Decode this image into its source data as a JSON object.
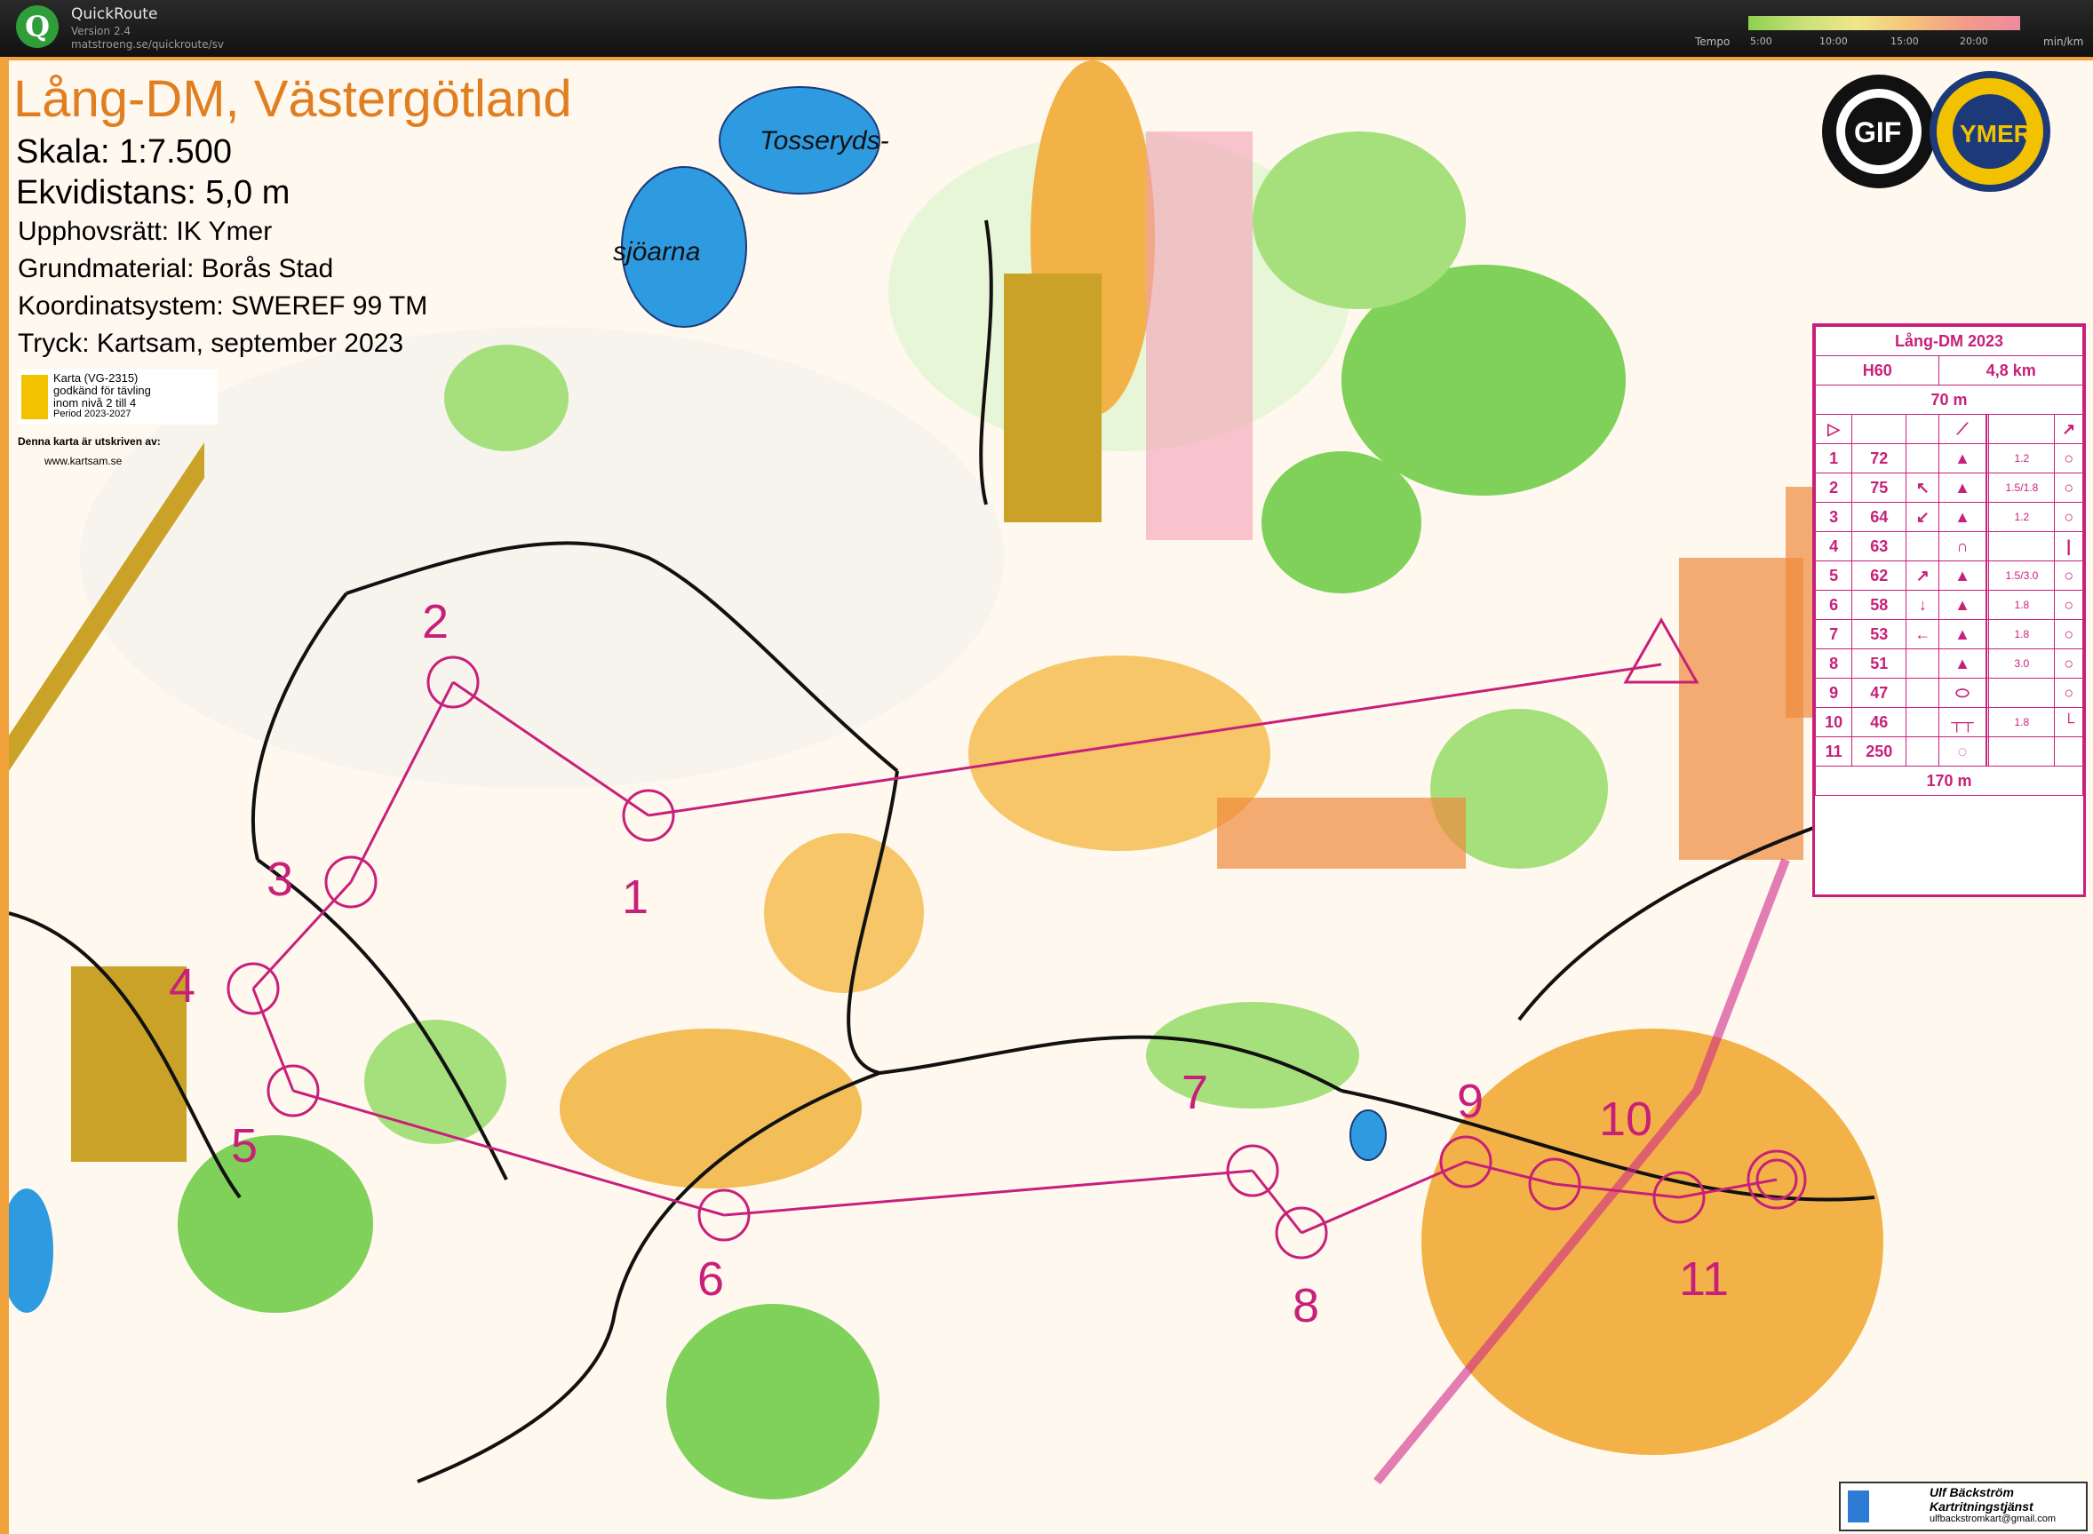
{
  "app": {
    "name": "QuickRoute",
    "version": "Version 2.4",
    "url": "matstroeng.se/quickroute/sv",
    "logo_letter": "Q"
  },
  "tempo": {
    "label": "Tempo",
    "ticks": [
      "5:00",
      "10:00",
      "15:00",
      "20:00"
    ],
    "unit": "min/km"
  },
  "map": {
    "title": "Lång-DM, Västergötland",
    "scale": "Skala: 1:7.500",
    "contour": "Ekvidistans: 5,0 m",
    "copyright": "Upphovsrätt: IK Ymer",
    "base_material": "Grundmaterial: Borås Stad",
    "coordinate_system": "Koordinatsystem: SWEREF 99 TM",
    "print": "Tryck: Kartsam, september 2023",
    "approval_lines": [
      "Karta (VG-2315)",
      "godkänd för tävling",
      "inom nivå 2 till 4",
      "Period 2023-2027"
    ],
    "printed_by": "Denna karta är utskriven av:",
    "printed_by_site": "www.kartsam.se",
    "lake_names": [
      "Tosseryds-",
      "sjöarna"
    ],
    "club_logos": [
      "Borås GIF",
      "Idrottsklubben Ymer 14.9 1917"
    ],
    "footer_name": "Ulf Bäckström",
    "footer_company": "Kartritningstjänst",
    "footer_email": "ulfbackstromkart@gmail.com",
    "control_numbers": [
      "1",
      "2",
      "3",
      "4",
      "5",
      "6",
      "7",
      "8",
      "9",
      "10",
      "11"
    ]
  },
  "description_sheet": {
    "event": "Lång-DM 2023",
    "class": "H60",
    "length": "4,8 km",
    "start_distance": "70 m",
    "finish_distance": "170 m",
    "rows": [
      {
        "n": "1",
        "code": "72",
        "dir": "",
        "size": "1.2"
      },
      {
        "n": "2",
        "code": "75",
        "dir": "↖",
        "size": "1.5/1.8"
      },
      {
        "n": "3",
        "code": "64",
        "dir": "↙",
        "size": "1.2"
      },
      {
        "n": "4",
        "code": "63",
        "dir": "",
        "size": ""
      },
      {
        "n": "5",
        "code": "62",
        "dir": "↗",
        "size": "1.5/3.0"
      },
      {
        "n": "6",
        "code": "58",
        "dir": "↓",
        "size": "1.8"
      },
      {
        "n": "7",
        "code": "53",
        "dir": "←",
        "size": "1.8"
      },
      {
        "n": "8",
        "code": "51",
        "dir": "",
        "size": "3.0"
      },
      {
        "n": "9",
        "code": "47",
        "dir": "",
        "size": ""
      },
      {
        "n": "10",
        "code": "46",
        "dir": "",
        "size": "1.8"
      },
      {
        "n": "11",
        "code": "250",
        "dir": "",
        "size": ""
      }
    ]
  }
}
